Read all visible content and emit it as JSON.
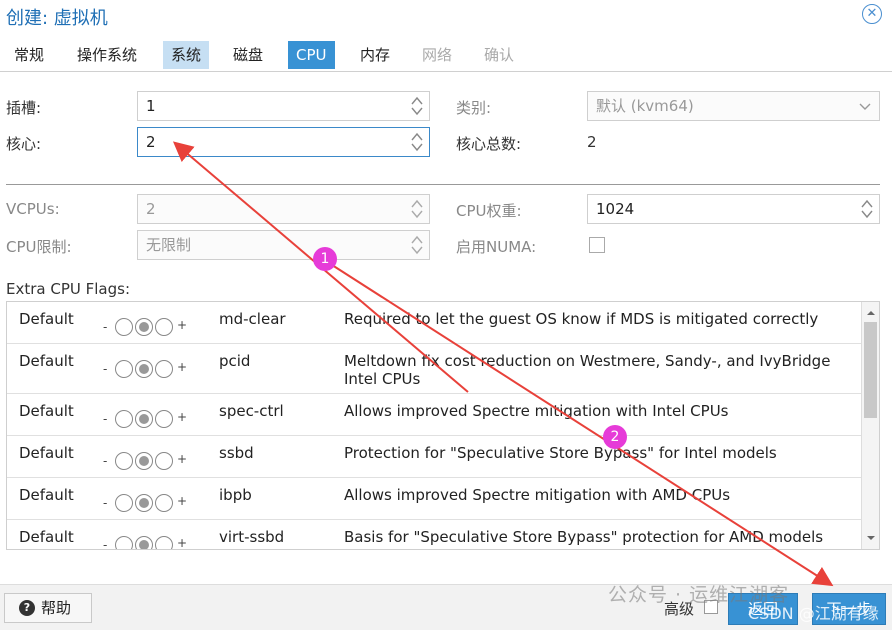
{
  "window": {
    "title": "创建: 虚拟机",
    "close_glyph": "✕"
  },
  "tabs": [
    {
      "label": "常规",
      "state": "normal"
    },
    {
      "label": "操作系统",
      "state": "normal"
    },
    {
      "label": "系统",
      "state": "highlight"
    },
    {
      "label": "磁盘",
      "state": "normal"
    },
    {
      "label": "CPU",
      "state": "active"
    },
    {
      "label": "内存",
      "state": "normal"
    },
    {
      "label": "网络",
      "state": "disabled"
    },
    {
      "label": "确认",
      "state": "disabled"
    }
  ],
  "form": {
    "sockets": {
      "label": "插槽:",
      "value": "1"
    },
    "cores": {
      "label": "核心:",
      "value": "2"
    },
    "type": {
      "label": "类别:",
      "value": "默认 (kvm64)"
    },
    "total_cores": {
      "label": "核心总数:",
      "value": "2"
    },
    "vcpus": {
      "label": "VCPUs:",
      "value": "2"
    },
    "cpu_limit": {
      "label": "CPU限制:",
      "value": "无限制"
    },
    "cpu_units": {
      "label": "CPU权重:",
      "value": "1024"
    },
    "numa": {
      "label": "启用NUMA:",
      "checked": false
    }
  },
  "extra_flags": {
    "label": "Extra CPU Flags:",
    "minus": "-",
    "plus": "+",
    "rows": [
      {
        "state": "Default",
        "flag": "md-clear",
        "description": "Required to let the guest OS know if MDS is mitigated correctly"
      },
      {
        "state": "Default",
        "flag": "pcid",
        "description": "Meltdown fix cost reduction on Westmere, Sandy-, and IvyBridge Intel CPUs"
      },
      {
        "state": "Default",
        "flag": "spec-ctrl",
        "description": "Allows improved Spectre mitigation with Intel CPUs"
      },
      {
        "state": "Default",
        "flag": "ssbd",
        "description": "Protection for \"Speculative Store Bypass\" for Intel models"
      },
      {
        "state": "Default",
        "flag": "ibpb",
        "description": "Allows improved Spectre mitigation with AMD CPUs"
      },
      {
        "state": "Default",
        "flag": "virt-ssbd",
        "description": "Basis for \"Speculative Store Bypass\" protection for AMD models"
      }
    ]
  },
  "footer": {
    "help_label": "帮助",
    "help_glyph": "?",
    "advanced_label": "高级",
    "back_label": "返回",
    "next_label": "下一步"
  },
  "annotations": {
    "badge1": "1",
    "badge2": "2",
    "arrow_color": "#e8413a",
    "badge_color": "#e63bd8"
  },
  "watermark": {
    "line1": "公众号 · 运维江湖客",
    "line2": "CSDN @江湖有缘"
  },
  "colors": {
    "accent": "#3892d4",
    "title": "#1f6fb5",
    "tab_highlight": "#c6dff3"
  }
}
